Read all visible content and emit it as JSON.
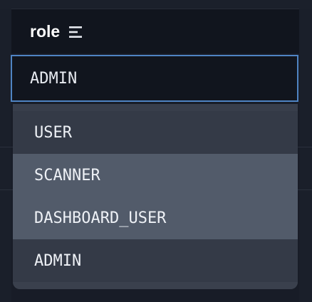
{
  "column": {
    "title": "role",
    "filter_icon": "filter-lines-icon"
  },
  "filter": {
    "value": "ADMIN"
  },
  "dropdown": {
    "options": [
      {
        "label": "USER",
        "highlighted": false
      },
      {
        "label": "SCANNER",
        "highlighted": true
      },
      {
        "label": "DASHBOARD_USER",
        "highlighted": true
      },
      {
        "label": "ADMIN",
        "highlighted": false
      }
    ]
  },
  "colors": {
    "accent_border": "#4f84c3",
    "header_bg": "#11151e",
    "option_bg": "#343a47",
    "option_highlight_bg": "#525b6a",
    "text": "#eef1f6"
  }
}
